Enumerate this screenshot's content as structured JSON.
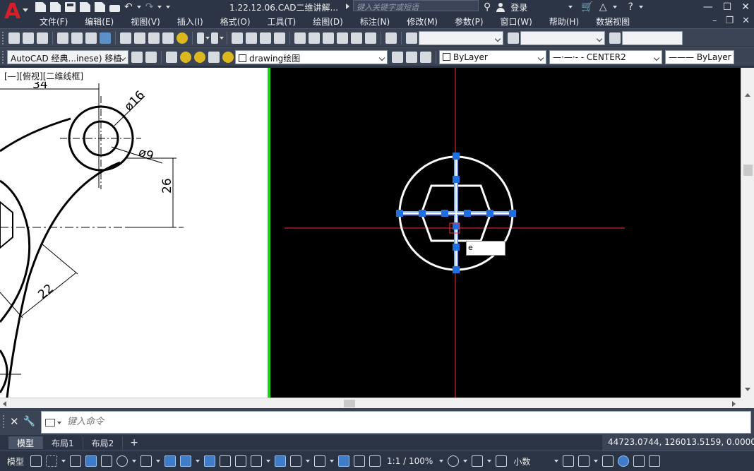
{
  "titlebar": {
    "document_title": "1.22.12.06.CAD二维讲解...",
    "search_placeholder": "键入关键字或短语",
    "login_label": "登录"
  },
  "menu": {
    "items": [
      "文件(F)",
      "编辑(E)",
      "视图(V)",
      "插入(I)",
      "格式(O)",
      "工具(T)",
      "绘图(D)",
      "标注(N)",
      "修改(M)",
      "参数(P)",
      "窗口(W)",
      "帮助(H)",
      "数据视图"
    ]
  },
  "toolbar2": {
    "workspace": "AutoCAD 经典...inese) 移植",
    "layer": "drawing绘图",
    "color": "ByLayer",
    "linetype": "CENTER2",
    "lineweight": "ByLayer"
  },
  "viewport": {
    "label": "[—][俯视][二维线框]"
  },
  "left_drawing": {
    "dim_34": "34",
    "dim_phi16": "ø16",
    "dim_phi9": "ø9",
    "dim_26": "26",
    "dim_22": "22"
  },
  "canvas": {
    "input_value": "e"
  },
  "command": {
    "placeholder": "键入命令"
  },
  "layout_tabs": [
    "模型",
    "布局1",
    "布局2"
  ],
  "coordinates": "44723.0744, 126013.5159, 0.0000",
  "status": {
    "model_label": "模型",
    "scale": "1:1 / 100%",
    "units": "小数"
  },
  "colors": {
    "canvas_bg": "#000000",
    "axis_red": "#ff2a2a",
    "grip_blue": "#1f6fe0",
    "divider_green": "#19d419",
    "logo_red": "#d3202a"
  },
  "icons": {
    "logo": "autocad-logo-icon",
    "search": "binoculars-icon",
    "user": "user-icon",
    "cart": "cart-icon",
    "help": "help-icon"
  }
}
